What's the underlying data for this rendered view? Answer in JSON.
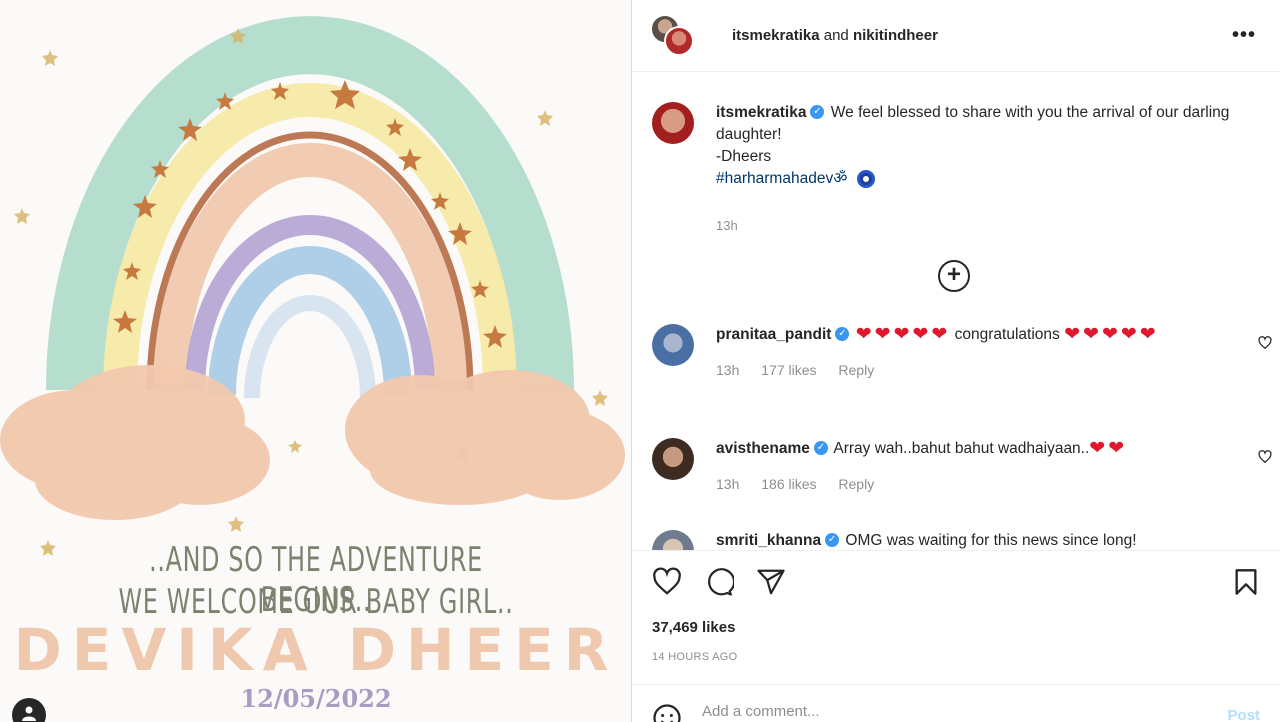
{
  "post": {
    "header": {
      "user1": "itsmekratika",
      "and": "and",
      "user2": "nikitindheer",
      "more": "•••"
    },
    "image": {
      "line1": "..AND SO THE ADVENTURE BEGINS..",
      "line2": "WE WELCOME OUR BABY GIRL..",
      "name": "DEVIKA DHEER",
      "date": "12/05/2022"
    },
    "caption": {
      "username": "itsmekratika",
      "verified": "✓",
      "text": "We feel blessed to share with you the arrival of our darling daughter!",
      "signoff": "-Dheers",
      "hashtag": "#harharmahadevॐ",
      "time": "13h"
    },
    "load_more": "+",
    "comments": [
      {
        "username": "pranitaa_pandit",
        "verified": "✓",
        "text": "congratulations",
        "time": "13h",
        "likes": "177 likes",
        "reply": "Reply"
      },
      {
        "username": "avisthename",
        "verified": "✓",
        "text": "Array wah..bahut bahut wadhaiyaan..",
        "time": "13h",
        "likes": "186 likes",
        "reply": "Reply"
      },
      {
        "username": "smriti_khanna",
        "verified": "✓",
        "text": "OMG was waiting for this news since long!"
      }
    ],
    "likes_count": "37,469 likes",
    "posted_ago": "14 HOURS AGO",
    "add_comment_placeholder": "Add a comment...",
    "post_button": "Post"
  },
  "colors": {
    "heart": "#e0182d",
    "verified": "#3897f0",
    "hashtag": "#00376b",
    "post_button": "#b2dffc"
  }
}
